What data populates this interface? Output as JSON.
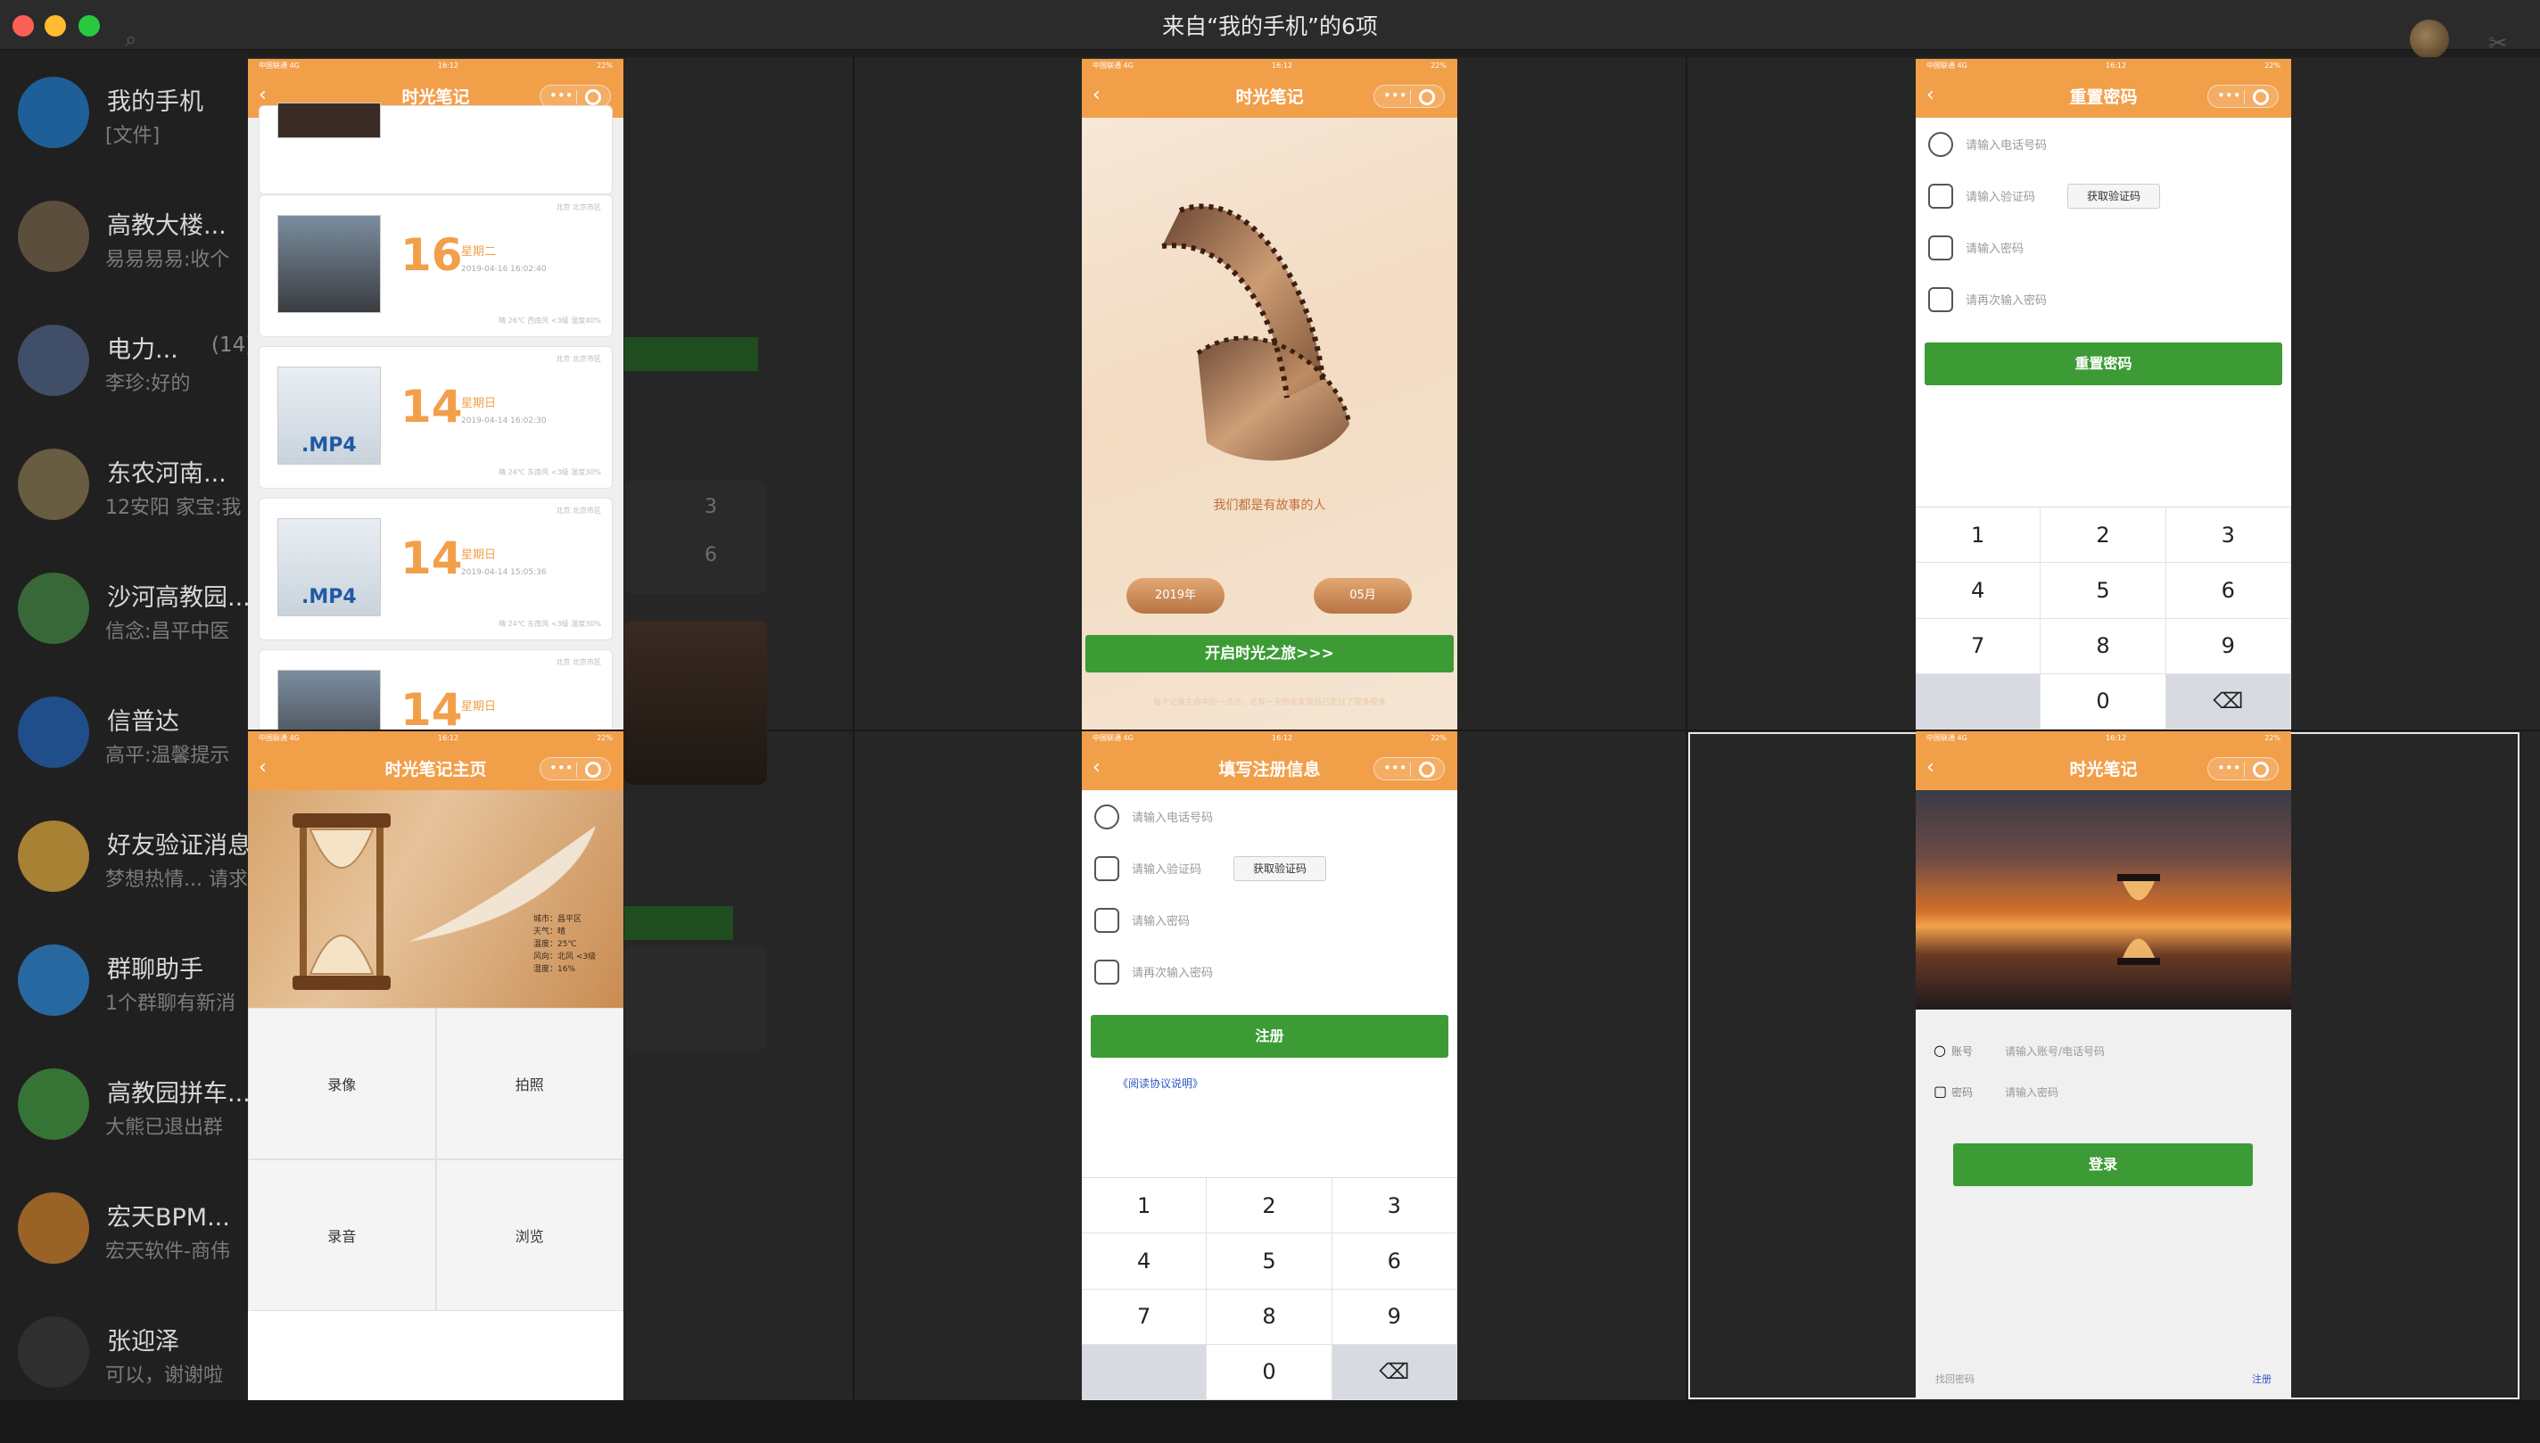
{
  "window": {
    "title": "来自“我的手机”的6项"
  },
  "chat_list": [
    {
      "name": "我的手机",
      "msg": "[文件]",
      "count": "",
      "color": "#1f6fb5"
    },
    {
      "name": "高教大楼...",
      "msg": "易易易易:收个",
      "count": "",
      "color": "#6b5a45"
    },
    {
      "name": "电力...",
      "msg": "李珍:好的",
      "count": "(14)",
      "color": "#4a5a7a"
    },
    {
      "name": "东农河南...",
      "msg": "12安阳 家宝:我",
      "count": "",
      "color": "#7a6b4a"
    },
    {
      "name": "沙河高教园...",
      "msg": "信念:昌平中医",
      "count": "",
      "color": "#3e7a3e"
    },
    {
      "name": "信普达",
      "msg": "高平:温馨提示",
      "count": "",
      "color": "#1f5aa5"
    },
    {
      "name": "好友验证消息",
      "msg": "梦想热情... 请求",
      "count": "",
      "color": "#c99a3a"
    },
    {
      "name": "群聊助手",
      "msg": "1个群聊有新消",
      "count": "",
      "color": "#2a7ac0"
    },
    {
      "name": "高教园拼车...",
      "msg": "大熊已退出群",
      "count": "",
      "color": "#3c8a3c"
    },
    {
      "name": "宏天BPM...",
      "msg": "宏天软件-商伟",
      "count": "",
      "color": "#b8742a"
    },
    {
      "name": "张迎泽",
      "msg": "可以，谢谢啦",
      "count": "",
      "color": "#333333"
    }
  ],
  "background": {
    "num_a": "3",
    "num_b": "6"
  },
  "phones": {
    "status": {
      "carrier": "中国联通 4G",
      "time": "16:12",
      "battery": "22%"
    },
    "p1": {
      "title": "时光笔记",
      "cards": [
        {
          "day": "16",
          "weekday": "星期二",
          "ts": "2019-04-16 16:02:40",
          "meta": "晴 26℃ 西南风 <3级 湿度40%",
          "loc": "北京 北京市区"
        },
        {
          "day": "14",
          "weekday": "星期日",
          "ts": "2019-04-14 16:02:30",
          "meta": "晴 24℃ 东南风 <3级 湿度30%",
          "loc": "北京 北京市区",
          "label": ".MP4"
        },
        {
          "day": "14",
          "weekday": "星期日",
          "ts": "2019-04-14 15:05:36",
          "meta": "晴 24℃ 东南风 <3级 湿度30%",
          "loc": "北京 北京市区",
          "label": ".MP4"
        },
        {
          "day": "14",
          "weekday": "星期日",
          "ts": "",
          "meta": "",
          "loc": "北京 北京市区"
        }
      ]
    },
    "p2": {
      "title": "时光笔记",
      "slogan": "我们都是有故事的人",
      "year": "2019年",
      "month": "05月",
      "start_button": "开启时光之旅>>>",
      "footer": "每个记录生命中的一点点，总有一天你会发现自己走过了很多很多"
    },
    "p3": {
      "title": "重置密码",
      "phone_placeholder": "请输入电话号码",
      "code_placeholder": "请输入验证码",
      "get_code": "获取验证码",
      "pwd_placeholder": "请输入密码",
      "pwd2_placeholder": "请再次输入密码",
      "button": "重置密码",
      "keys": [
        "1",
        "2",
        "3",
        "4",
        "5",
        "6",
        "7",
        "8",
        "9",
        "",
        "0",
        "⌫"
      ]
    },
    "p4": {
      "title": "时光笔记主页",
      "weather": [
        "城市：昌平区",
        "天气：晴",
        "温度：25℃",
        "风向：北风 <3级",
        "湿度：16%"
      ],
      "tiles": [
        "录像",
        "拍照",
        "录音",
        "浏览"
      ]
    },
    "p5": {
      "title": "填写注册信息",
      "phone_placeholder": "请输入电话号码",
      "code_placeholder": "请输入验证码",
      "get_code": "获取验证码",
      "pwd_placeholder": "请输入密码",
      "pwd2_placeholder": "请再次输入密码",
      "button": "注册",
      "agreement": "《阅读协议说明》",
      "keys": [
        "1",
        "2",
        "3",
        "4",
        "5",
        "6",
        "7",
        "8",
        "9",
        "",
        "0",
        "⌫"
      ]
    },
    "p6": {
      "title": "时光笔记",
      "account_label": "账号",
      "account_placeholder": "请输入账号/电话号码",
      "password_label": "密码",
      "password_placeholder": "请输入密码",
      "login": "登录",
      "forgot": "找回密码",
      "register": "注册"
    }
  },
  "colors": {
    "accent": "#f29f4a",
    "green": "#3c9b35",
    "selection": "#e8e8e8"
  }
}
